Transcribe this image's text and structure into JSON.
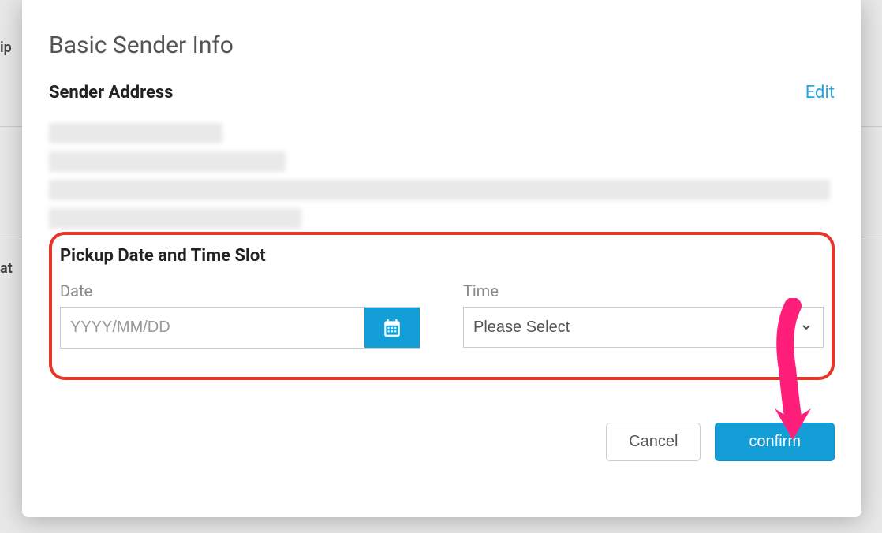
{
  "background": {
    "partial_text_1": "ip",
    "partial_text_2": "at"
  },
  "modal": {
    "title": "Basic Sender Info",
    "sender_address_label": "Sender Address",
    "edit_link": "Edit",
    "pickup_section": {
      "title": "Pickup Date and Time Slot",
      "date_label": "Date",
      "date_placeholder": "YYYY/MM/DD",
      "time_label": "Time",
      "time_placeholder": "Please Select"
    },
    "buttons": {
      "cancel": "Cancel",
      "confirm": "confirm"
    }
  }
}
